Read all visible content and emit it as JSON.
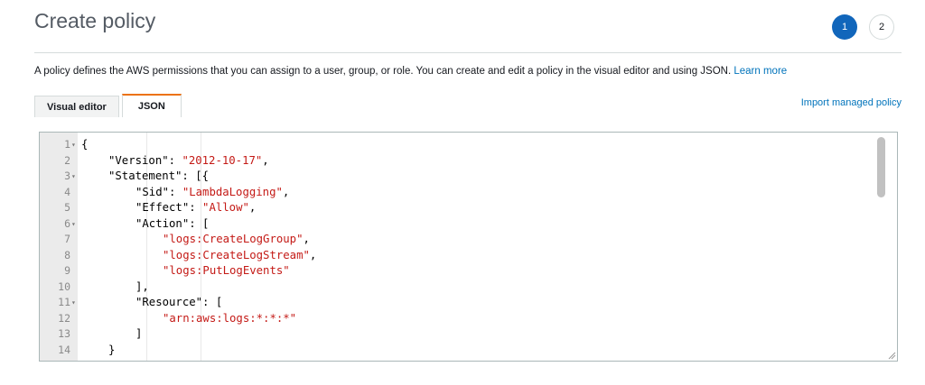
{
  "header": {
    "title": "Create policy",
    "steps": [
      "1",
      "2"
    ]
  },
  "description": {
    "text": "A policy defines the AWS permissions that you can assign to a user, group, or role. You can create and edit a policy in the visual editor and using JSON. ",
    "link": "Learn more"
  },
  "tabs": {
    "visual_editor": "Visual editor",
    "json": "JSON"
  },
  "import_link": "Import managed policy",
  "editor": {
    "lines": [
      {
        "n": "1",
        "fold": true,
        "indent": 0,
        "parts": [
          [
            "p",
            "{"
          ]
        ]
      },
      {
        "n": "2",
        "fold": false,
        "indent": 1,
        "parts": [
          [
            "p",
            "\"Version\": "
          ],
          [
            "s",
            "\"2012-10-17\""
          ],
          [
            "p",
            ","
          ]
        ]
      },
      {
        "n": "3",
        "fold": true,
        "indent": 1,
        "parts": [
          [
            "p",
            "\"Statement\": [{"
          ]
        ]
      },
      {
        "n": "4",
        "fold": false,
        "indent": 2,
        "parts": [
          [
            "p",
            "\"Sid\": "
          ],
          [
            "s",
            "\"LambdaLogging\""
          ],
          [
            "p",
            ","
          ]
        ]
      },
      {
        "n": "5",
        "fold": false,
        "indent": 2,
        "parts": [
          [
            "p",
            "\"Effect\": "
          ],
          [
            "s",
            "\"Allow\""
          ],
          [
            "p",
            ","
          ]
        ]
      },
      {
        "n": "6",
        "fold": true,
        "indent": 2,
        "parts": [
          [
            "p",
            "\"Action\": ["
          ]
        ]
      },
      {
        "n": "7",
        "fold": false,
        "indent": 3,
        "parts": [
          [
            "s",
            "\"logs:CreateLogGroup\""
          ],
          [
            "p",
            ","
          ]
        ]
      },
      {
        "n": "8",
        "fold": false,
        "indent": 3,
        "parts": [
          [
            "s",
            "\"logs:CreateLogStream\""
          ],
          [
            "p",
            ","
          ]
        ]
      },
      {
        "n": "9",
        "fold": false,
        "indent": 3,
        "parts": [
          [
            "s",
            "\"logs:PutLogEvents\""
          ]
        ]
      },
      {
        "n": "10",
        "fold": false,
        "indent": 2,
        "parts": [
          [
            "p",
            "],"
          ]
        ]
      },
      {
        "n": "11",
        "fold": true,
        "indent": 2,
        "parts": [
          [
            "p",
            "\"Resource\": ["
          ]
        ]
      },
      {
        "n": "12",
        "fold": false,
        "indent": 3,
        "parts": [
          [
            "s",
            "\"arn:aws:logs:*:*:*\""
          ]
        ]
      },
      {
        "n": "13",
        "fold": false,
        "indent": 2,
        "parts": [
          [
            "p",
            "]"
          ]
        ]
      },
      {
        "n": "14",
        "fold": false,
        "indent": 1,
        "parts": [
          [
            "p",
            "}"
          ]
        ]
      }
    ]
  },
  "colors": {
    "accent": "#1166bb",
    "link": "#0073bb",
    "tab_highlight": "#ec7211",
    "string": "#c41a16"
  },
  "icons": {
    "fold": "triangle-down-icon",
    "resize": "resize-grip-icon"
  }
}
